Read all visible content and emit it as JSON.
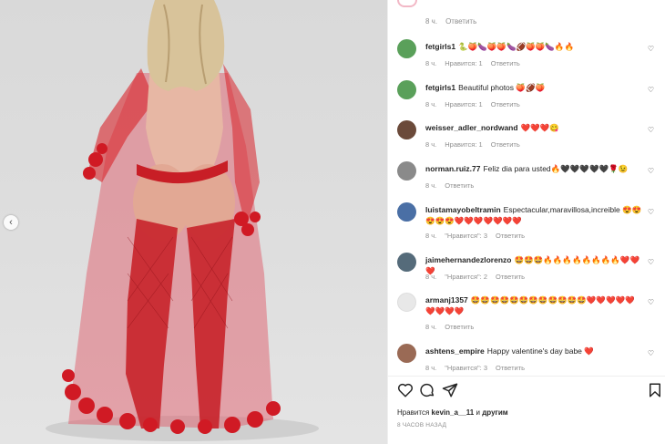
{
  "top": {
    "time": "8 ч.",
    "reply": "Ответить"
  },
  "comments": [
    {
      "user": "fetgirls1",
      "text": "🐍🍑🍆🍑🍑🍆🏈🍑🍑🍆🔥🔥",
      "time": "8 ч.",
      "likes": "Нравится: 1",
      "reply": "Ответить",
      "avatar_color": "#5aa05a"
    },
    {
      "user": "fetgirls1",
      "text": "Beautiful photos 🍑🏈🍑",
      "time": "8 ч.",
      "likes": "Нравится: 1",
      "reply": "Ответить",
      "avatar_color": "#5aa05a"
    },
    {
      "user": "weisser_adler_nordwand",
      "text": "❤️❤️❤️😋",
      "time": "8 ч.",
      "likes": "Нравится: 1",
      "reply": "Ответить",
      "avatar_color": "#6b4a3a"
    },
    {
      "user": "norman.ruiz.77",
      "text": "Feliz dia para usted🔥🖤🖤🖤🖤🖤🌹😉",
      "time": "8 ч.",
      "likes": "",
      "reply": "Ответить",
      "avatar_color": "#8a8a8a"
    },
    {
      "user": "luistamayobeltramin",
      "text": "Espectacular,maravillosa,increible 😍😍😍😍😍❤️❤️❤️❤️❤️❤️❤️",
      "time": "8 ч.",
      "likes": "\"Нравится\": 3",
      "reply": "Ответить",
      "avatar_color": "#4a6fa5"
    },
    {
      "user": "jaimehernandezlorenzo",
      "text": "🤩🤩🤩🔥🔥🔥🔥🔥🔥🔥🔥❤️❤️❤️",
      "time": "8 ч.",
      "likes": "\"Нравится\": 2",
      "reply": "Ответить",
      "avatar_color": "#556b7a"
    },
    {
      "user": "armanj1357",
      "text": "🤩🤩🤩🤩🤩🤩🤩🤩🤩🤩🤩🤩❤️❤️❤️❤️❤️❤️❤️❤️❤️",
      "time": "8 ч.",
      "likes": "",
      "reply": "Ответить",
      "avatar_color": "#e8e8e8"
    },
    {
      "user": "ashtens_empire",
      "text": "Happy valentine's day babe ❤️",
      "time": "8 ч.",
      "likes": "\"Нравится\": 3",
      "reply": "Ответить",
      "avatar_color": "#9a6a55"
    }
  ],
  "icons": {
    "prev": "chevron-left-icon",
    "like": "heart-icon",
    "comment": "comment-icon",
    "share": "send-icon",
    "save": "bookmark-icon"
  },
  "likes_line": {
    "prefix": "Нравится",
    "user": "kevin_a__11",
    "middle": "и",
    "others": "другим"
  },
  "posted_ago": "8 часов назад",
  "colors": {
    "dress": "#d8232a",
    "background": "#dcdcdc",
    "muted_text": "#8e8e8e"
  }
}
